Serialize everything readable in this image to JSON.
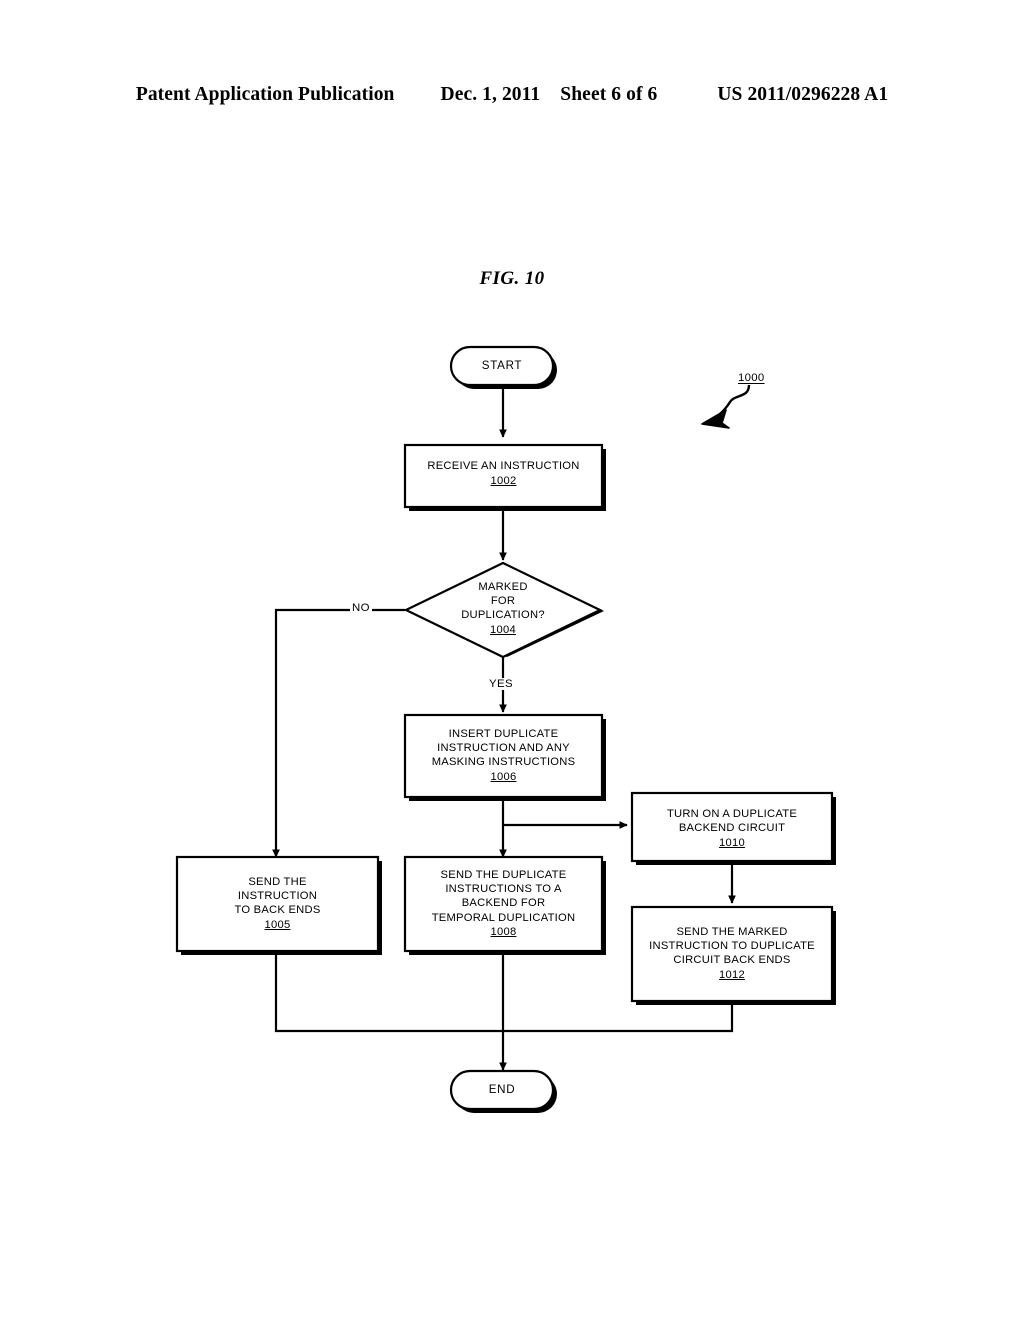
{
  "header": {
    "publication": "Patent Application Publication",
    "date": "Dec. 1, 2011",
    "sheet": "Sheet 6 of 6",
    "patent_number": "US 2011/0296228 A1"
  },
  "figure": {
    "title": "FIG. 10",
    "reference_numeral": "1000"
  },
  "flowchart": {
    "type": "flowchart",
    "nodes": [
      {
        "id": "start",
        "shape": "terminator",
        "label": "START",
        "ref": ""
      },
      {
        "id": "n1002",
        "shape": "process",
        "label": "RECEIVE AN INSTRUCTION",
        "ref": "1002"
      },
      {
        "id": "n1004",
        "shape": "decision",
        "line1": "MARKED",
        "line2": "FOR",
        "line3": "DUPLICATION?",
        "ref": "1004"
      },
      {
        "id": "n1006",
        "shape": "process",
        "line1": "INSERT DUPLICATE",
        "line2": "INSTRUCTION AND ANY",
        "line3": "MASKING INSTRUCTIONS",
        "ref": "1006"
      },
      {
        "id": "n1005",
        "shape": "process",
        "line1": "SEND THE",
        "line2": "INSTRUCTION",
        "line3": "TO BACK ENDS",
        "ref": "1005"
      },
      {
        "id": "n1008",
        "shape": "process",
        "line1": "SEND THE DUPLICATE",
        "line2": "INSTRUCTIONS TO A",
        "line3": "BACKEND FOR",
        "line4": "TEMPORAL DUPLICATION",
        "ref": "1008"
      },
      {
        "id": "n1010",
        "shape": "process",
        "line1": "TURN ON A DUPLICATE",
        "line2": "BACKEND CIRCUIT",
        "ref": "1010"
      },
      {
        "id": "n1012",
        "shape": "process",
        "line1": "SEND THE MARKED",
        "line2": "INSTRUCTION TO DUPLICATE",
        "line3": "CIRCUIT BACK ENDS",
        "ref": "1012"
      },
      {
        "id": "end",
        "shape": "terminator",
        "label": "END",
        "ref": ""
      }
    ],
    "branch_labels": {
      "no": "NO",
      "yes": "YES"
    },
    "colors": {
      "line": "#000000",
      "fill": "#ffffff",
      "text": "#000000"
    }
  }
}
